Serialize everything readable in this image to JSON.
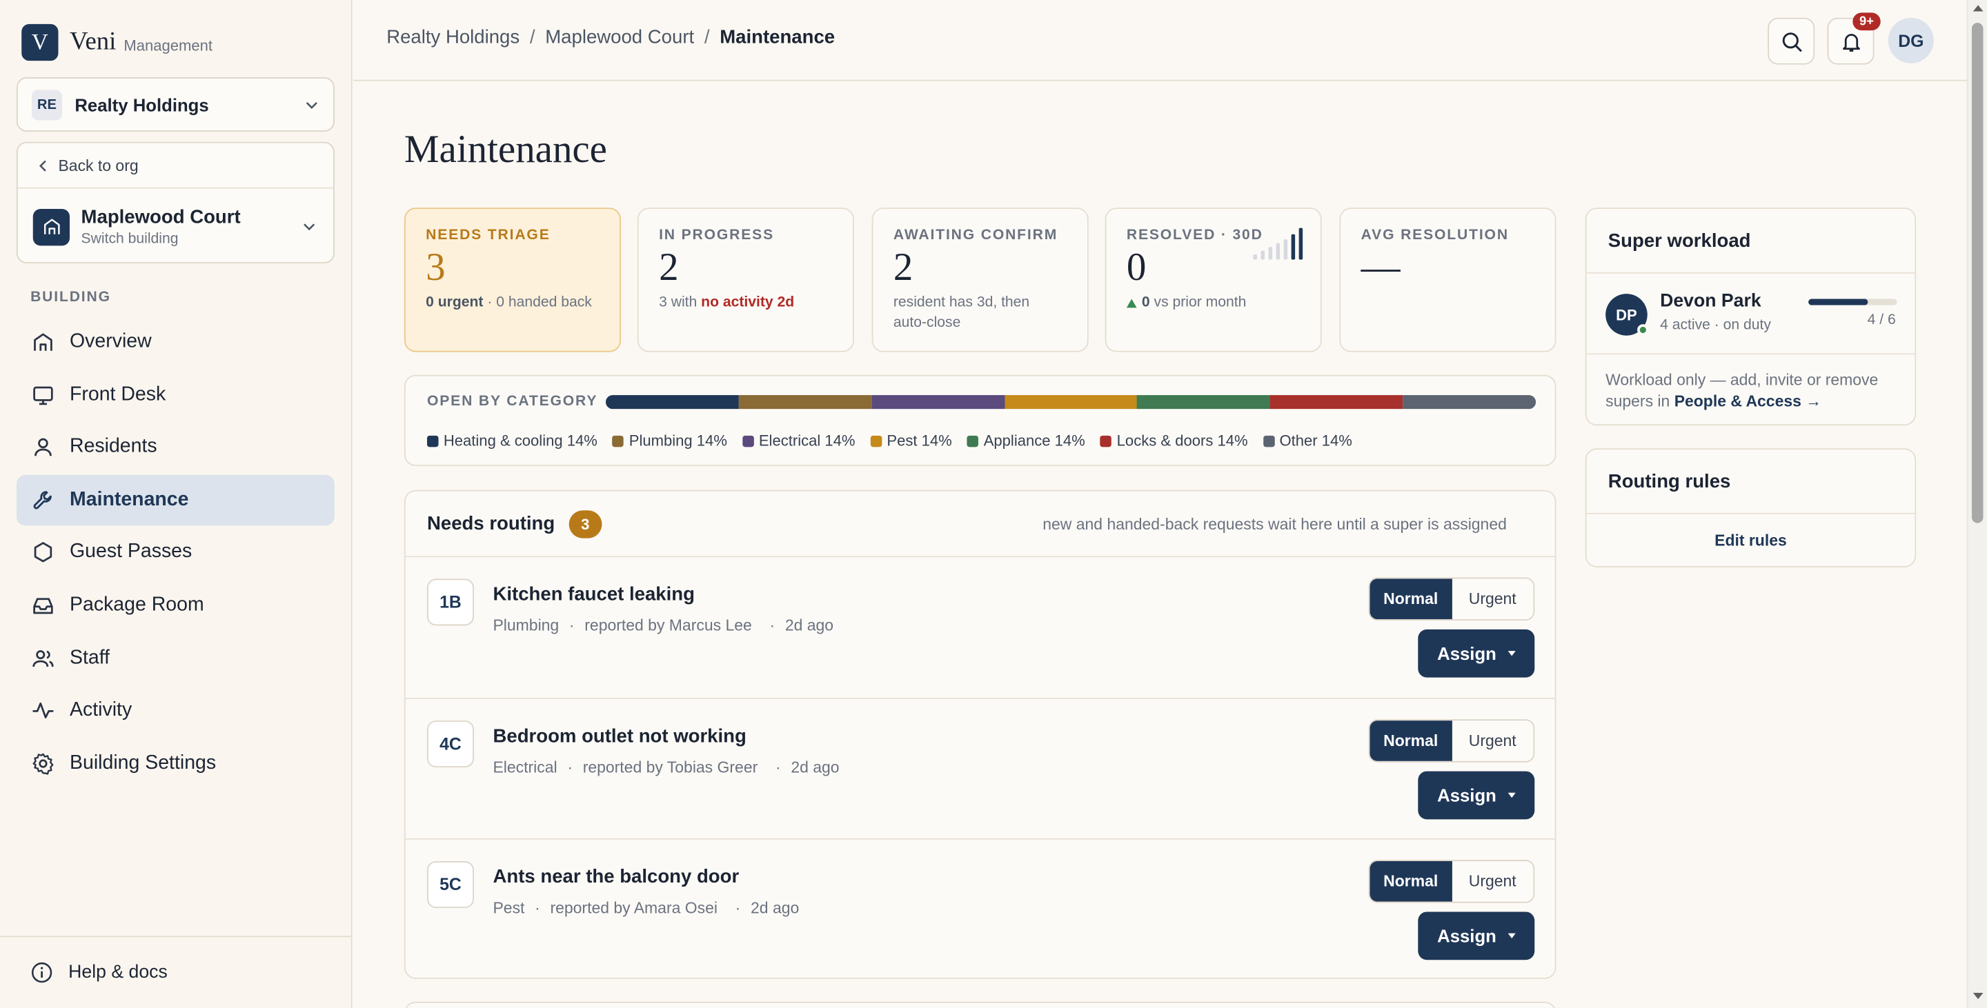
{
  "brand": {
    "name": "Veni",
    "sub": "Management",
    "logo_letter": "V"
  },
  "org": {
    "badge": "RE",
    "name": "Realty Holdings"
  },
  "building": {
    "back_label": "Back to org",
    "name": "Maplewood Court",
    "sub": "Switch building"
  },
  "sidebar": {
    "section_label": "BUILDING",
    "items": [
      {
        "label": "Overview",
        "icon": "home-icon"
      },
      {
        "label": "Front Desk",
        "icon": "monitor-icon"
      },
      {
        "label": "Residents",
        "icon": "user-icon"
      },
      {
        "label": "Maintenance",
        "icon": "wrench-icon",
        "active": true
      },
      {
        "label": "Guest Passes",
        "icon": "hexagon-icon"
      },
      {
        "label": "Package Room",
        "icon": "inbox-icon"
      },
      {
        "label": "Staff",
        "icon": "users-icon"
      },
      {
        "label": "Activity",
        "icon": "activity-icon"
      },
      {
        "label": "Building Settings",
        "icon": "gear-icon"
      }
    ],
    "footer_label": "Help & docs"
  },
  "topbar": {
    "breadcrumb": [
      "Realty Holdings",
      "Maplewood Court",
      "Maintenance"
    ],
    "notif_badge": "9+",
    "avatar": "DG"
  },
  "page": {
    "title": "Maintenance"
  },
  "kpis": {
    "triage": {
      "label": "NEEDS TRIAGE",
      "value": "3",
      "sub_bold": "0 urgent",
      "sub_rest": " · 0 handed back"
    },
    "progress": {
      "label": "IN PROGRESS",
      "value": "2",
      "sub_pre": "3 with ",
      "sub_warn": "no activity 2d"
    },
    "awaiting": {
      "label": "AWAITING CONFIRM",
      "value": "2",
      "sub": "resident has 3d, then auto-close"
    },
    "resolved": {
      "label": "RESOLVED · 30D",
      "value": "0",
      "sub_bold": "0",
      "sub_rest": " vs prior month"
    },
    "avg": {
      "label": "AVG RESOLUTION",
      "value": "—"
    }
  },
  "categories": {
    "label": "OPEN BY CATEGORY",
    "items": [
      {
        "label": "Heating & cooling 14%",
        "color": "#1f3757",
        "share": 14
      },
      {
        "label": "Plumbing 14%",
        "color": "#8a6a35",
        "share": 14
      },
      {
        "label": "Electrical 14%",
        "color": "#5a4a7e",
        "share": 14
      },
      {
        "label": "Pest 14%",
        "color": "#c58a1a",
        "share": 14
      },
      {
        "label": "Appliance 14%",
        "color": "#3f7a52",
        "share": 14
      },
      {
        "label": "Locks & doors 14%",
        "color": "#a8302c",
        "share": 14
      },
      {
        "label": "Other 14%",
        "color": "#5b6470",
        "share": 14
      }
    ]
  },
  "routing": {
    "title": "Needs routing",
    "count": "3",
    "hint": "new and handed-back requests wait here until a super is assigned",
    "normal_label": "Normal",
    "urgent_label": "Urgent",
    "assign_label": "Assign",
    "requests": [
      {
        "unit": "1B",
        "title": "Kitchen faucet leaking",
        "category": "Plumbing",
        "reporter": "reported by Marcus Lee",
        "age": "2d ago"
      },
      {
        "unit": "4C",
        "title": "Bedroom outlet not working",
        "category": "Electrical",
        "reporter": "reported by Tobias Greer",
        "age": "2d ago"
      },
      {
        "unit": "5C",
        "title": "Ants near the balcony door",
        "category": "Pest",
        "reporter": "reported by Amara Osei",
        "age": "2d ago"
      }
    ]
  },
  "workload": {
    "title": "Super workload",
    "person": {
      "initials": "DP",
      "name": "Devon Park",
      "sub": "4 active · on duty",
      "count": "4 / 6",
      "load": 0.667
    },
    "note_pre": "Workload only — add, invite or remove supers in ",
    "note_link": "People & Access →"
  },
  "rules": {
    "title": "Routing rules",
    "edit_label": "Edit rules"
  }
}
